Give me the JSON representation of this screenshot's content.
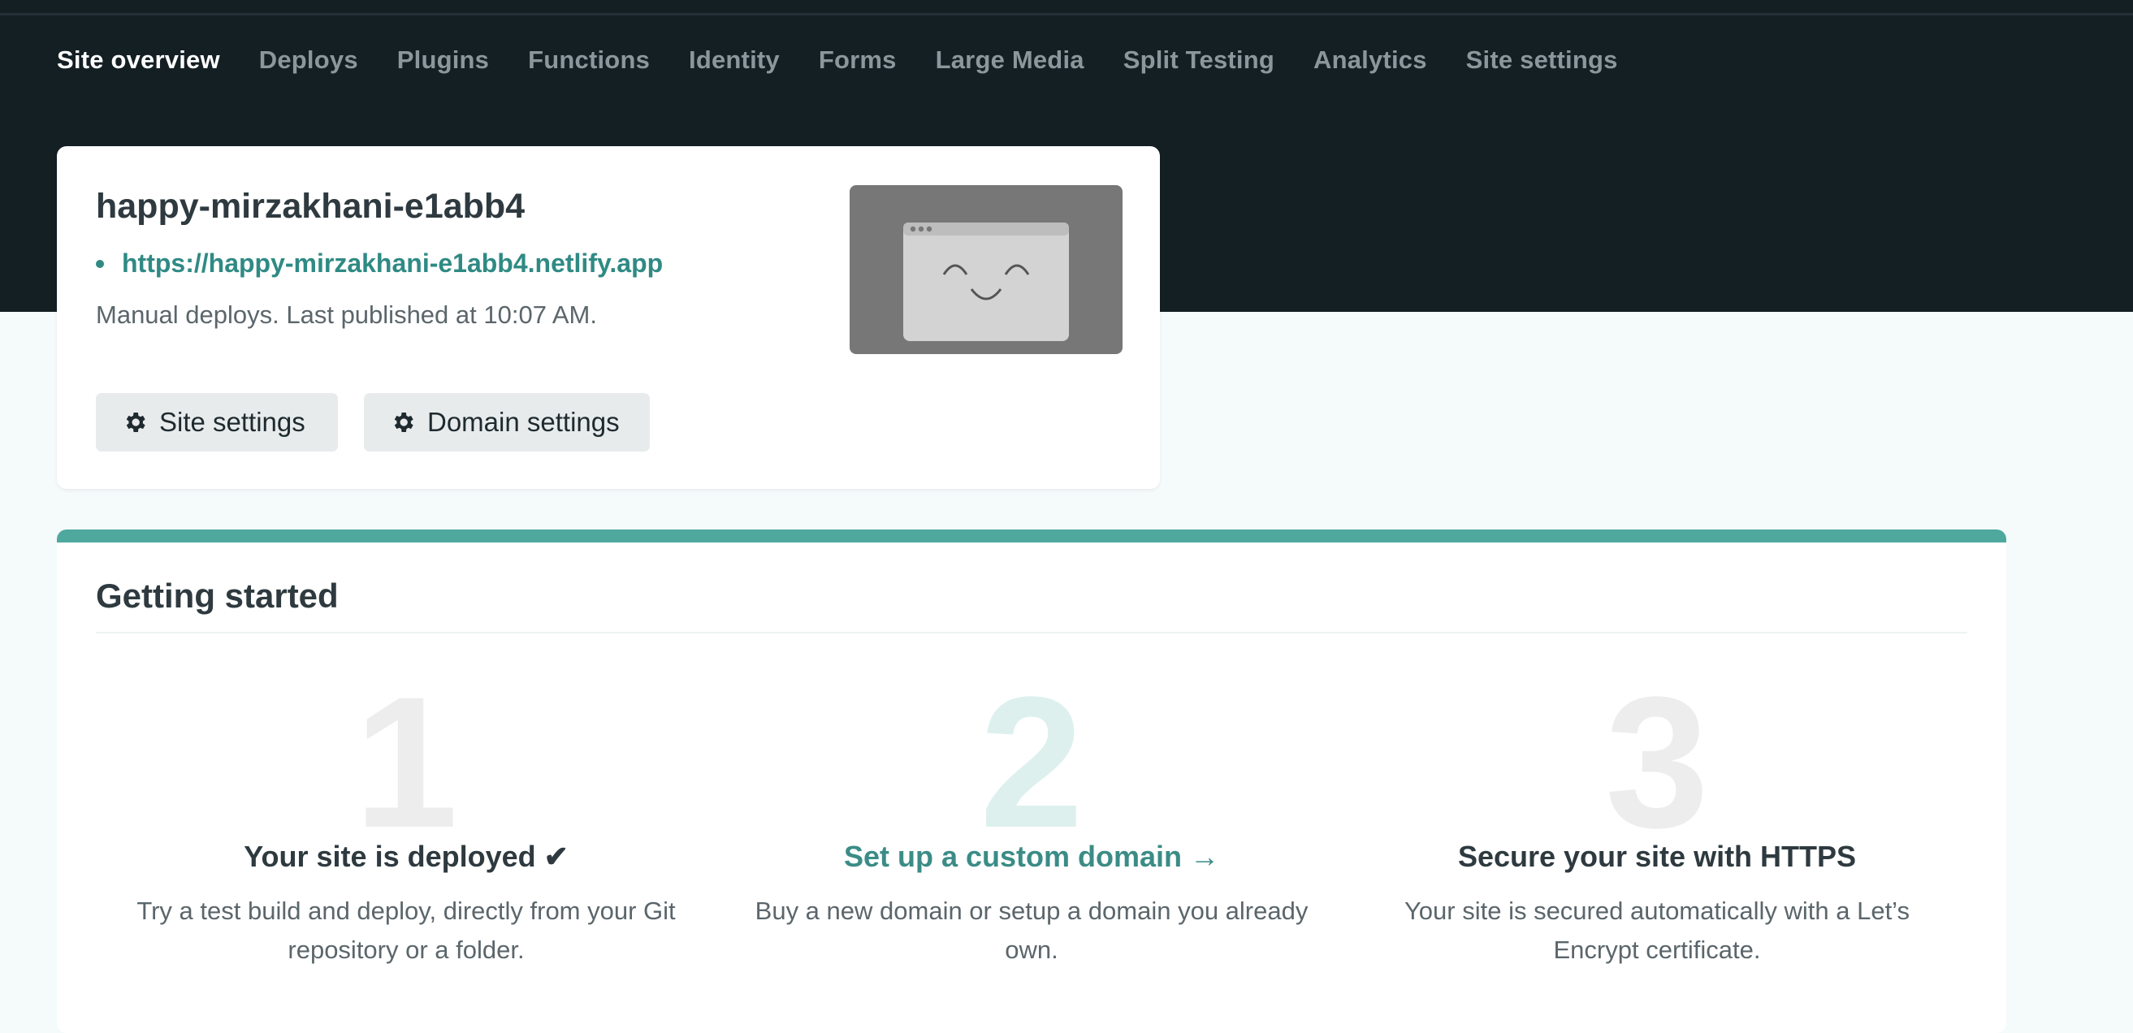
{
  "nav": {
    "items": [
      {
        "label": "Site overview"
      },
      {
        "label": "Deploys"
      },
      {
        "label": "Plugins"
      },
      {
        "label": "Functions"
      },
      {
        "label": "Identity"
      },
      {
        "label": "Forms"
      },
      {
        "label": "Large Media"
      },
      {
        "label": "Split Testing"
      },
      {
        "label": "Analytics"
      },
      {
        "label": "Site settings"
      }
    ],
    "active": "Site overview"
  },
  "site": {
    "name": "happy-mirzakhani-e1abb4",
    "url": "https://happy-mirzakhani-e1abb4.netlify.app",
    "status": "Manual deploys. Last published at 10:07 AM.",
    "buttons": {
      "site_settings": "Site settings",
      "domain_settings": "Domain settings"
    },
    "thumbnail_icon": "smiling-browser-window-icon"
  },
  "getting_started": {
    "title": "Getting started",
    "steps": [
      {
        "number": "1",
        "title": "Your site is deployed ✔",
        "description": "Try a test build and deploy, directly from your Git repository or a folder."
      },
      {
        "number": "2",
        "title": "Set up a custom domain →",
        "description": "Buy a new domain or setup a domain you already own."
      },
      {
        "number": "3",
        "title": "Secure your site with HTTPS",
        "description": "Your site is secured automatically with a Let’s Encrypt certificate."
      }
    ]
  },
  "colors": {
    "header_bg": "#141f24",
    "accent": "#4fa89d",
    "link": "#2f8a84",
    "page_bg": "#f5fafb"
  }
}
